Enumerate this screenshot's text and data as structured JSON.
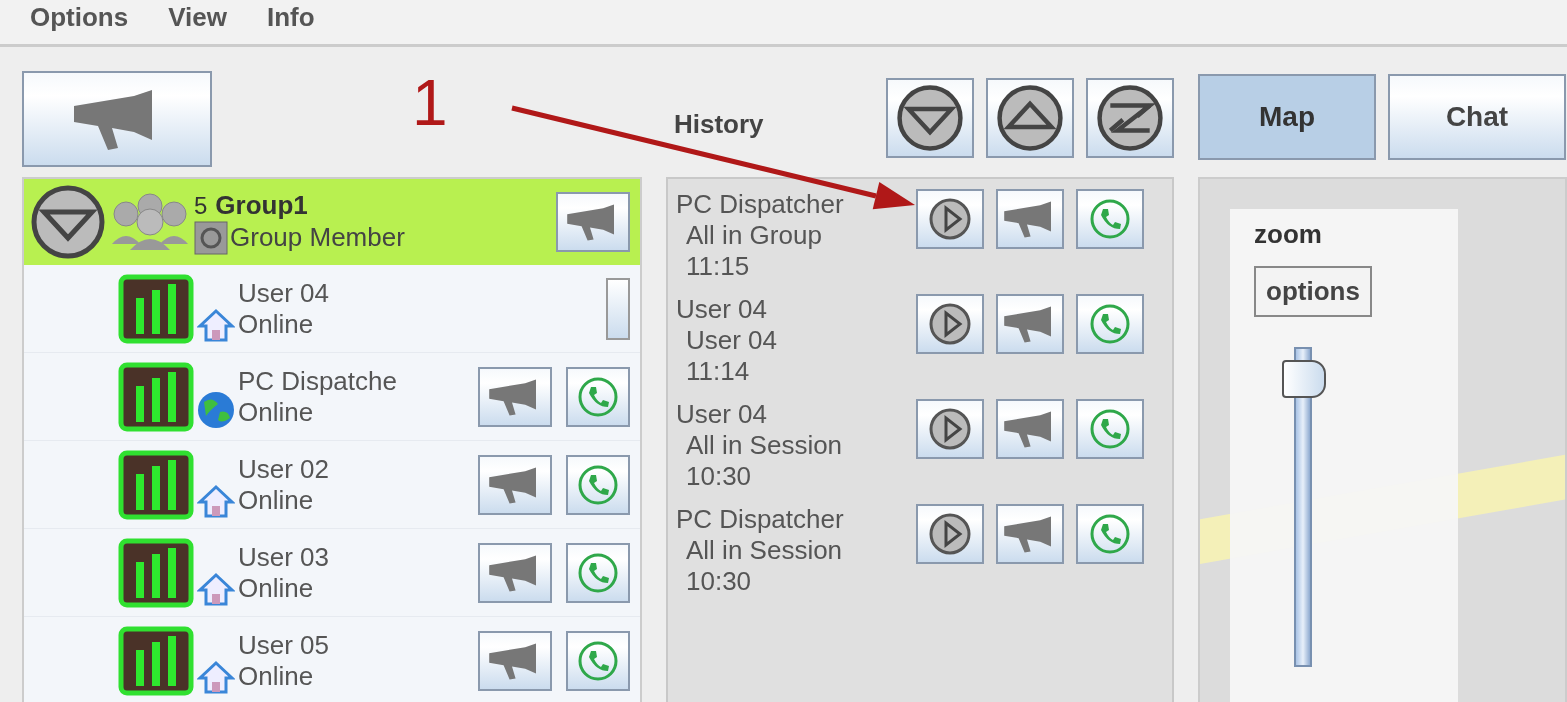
{
  "menu": [
    "Options",
    "View",
    "Info"
  ],
  "annotation": {
    "label": "1"
  },
  "group": {
    "count": "5",
    "name": "Group1",
    "role": "Group Member",
    "expanded": true
  },
  "members": [
    {
      "kind": "self",
      "name": "User 04",
      "status": "Online",
      "presence": {
        "kind": "home"
      }
    },
    {
      "kind": "contact",
      "name": "PC Dispatche",
      "status": "Online",
      "presence": {
        "kind": "globe"
      }
    },
    {
      "kind": "contact",
      "name": "User 02",
      "status": "Online",
      "presence": {
        "kind": "home"
      }
    },
    {
      "kind": "contact",
      "name": "User 03",
      "status": "Online",
      "presence": {
        "kind": "home"
      }
    },
    {
      "kind": "contact",
      "name": "User 05",
      "status": "Online",
      "presence": {
        "kind": "home"
      }
    }
  ],
  "history": {
    "title": "History",
    "entries": [
      {
        "from": "PC Dispatcher",
        "to": "All in Group",
        "time": "11:15"
      },
      {
        "from": "User 04",
        "to": "User 04",
        "time": "11:14"
      },
      {
        "from": "User 04",
        "to": "All in Session",
        "time": "10:30"
      },
      {
        "from": "PC Dispatcher",
        "to": "All in Session",
        "time": "10:30"
      }
    ]
  },
  "tabs": [
    {
      "label": "Map",
      "selected": true
    },
    {
      "label": "Chat",
      "selected": false
    }
  ],
  "map": {
    "zoom_label": "zoom",
    "options_button": "options",
    "zoom_slider": {
      "level": 0.95
    }
  }
}
